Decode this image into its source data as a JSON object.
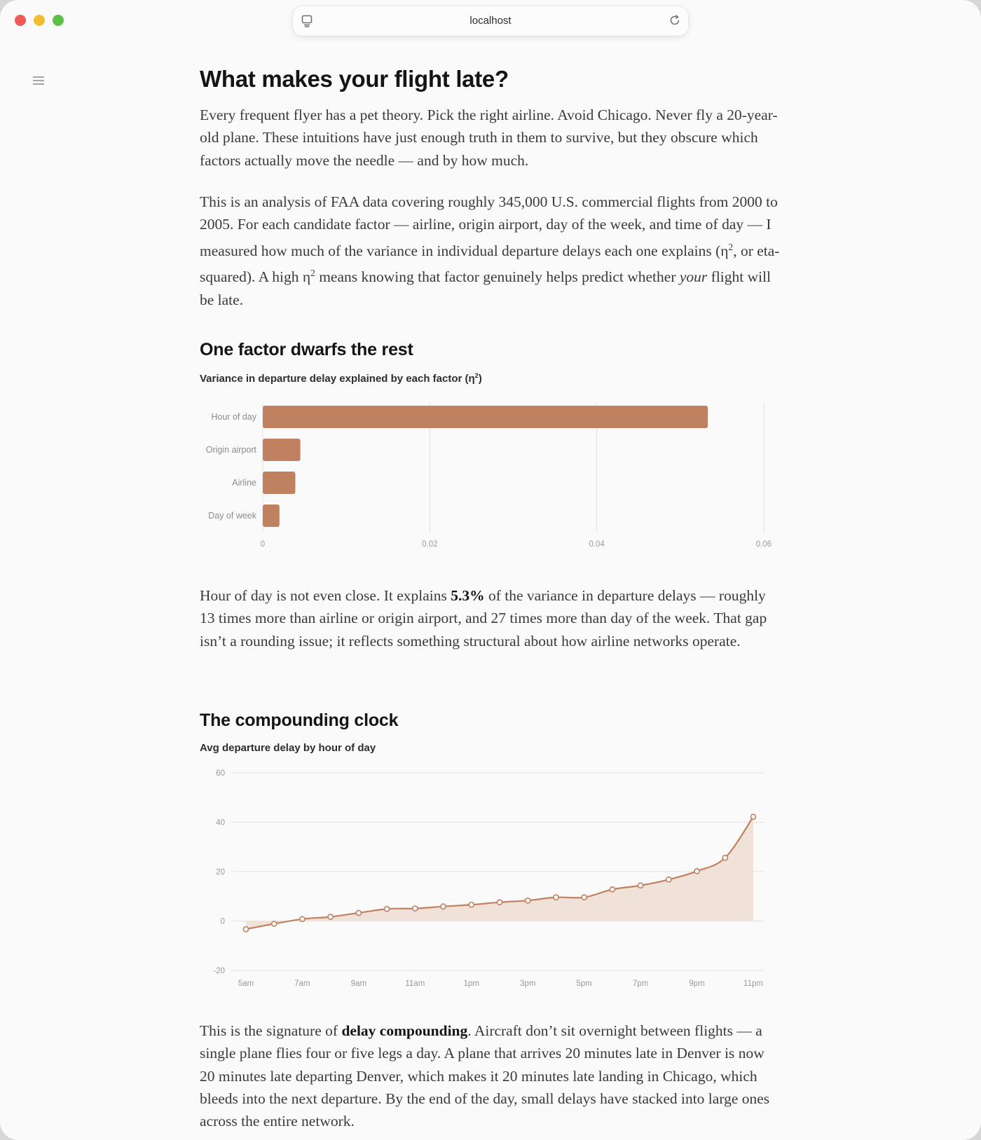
{
  "browser": {
    "url": "localhost"
  },
  "article": {
    "title": "What makes your flight late?",
    "intro_1": "Every frequent flyer has a pet theory. Pick the right airline. Avoid Chicago. Never fly a 20-year-old plane. These intuitions have just enough truth in them to survive, but they obscure which factors actually move the needle — and by how much.",
    "intro_2_a": "This is an analysis of FAA data covering roughly 345,000 U.S. commercial flights from 2000 to 2005. For each candidate factor — airline, origin airport, day of the week, and time of day — I measured how much of the variance in individual departure delays each one explains (η",
    "intro_2_sup1": "2",
    "intro_2_b": ", or eta-squared). A high η",
    "intro_2_sup2": "2",
    "intro_2_c": " means knowing that factor genuinely helps predict whether ",
    "intro_2_em": "your",
    "intro_2_d": " flight will be late.",
    "section_1": {
      "heading": "One factor dwarfs the rest",
      "chart_title_a": "Variance in departure delay explained by each factor (η",
      "chart_title_sup": "2",
      "chart_title_b": ")",
      "para_a": "Hour of day is not even close. It explains ",
      "para_bold": "5.3%",
      "para_b": " of the variance in departure delays — roughly 13 times more than airline or origin airport, and 27 times more than day of the week. That gap isn’t a rounding issue; it reflects something structural about how airline networks operate."
    },
    "section_2": {
      "heading": "The compounding clock",
      "chart_title": "Avg departure delay by hour of day",
      "para_a": "This is the signature of ",
      "para_bold": "delay compounding",
      "para_b": ". Aircraft don’t sit overnight between flights — a single plane flies four or five legs a day. A plane that arrives 20 minutes late in Denver is now 20 minutes late departing Denver, which makes it 20 minutes late landing in Chicago, which bleeds into the next departure. By the end of the day, small delays have stacked into large ones across the entire network."
    }
  },
  "icons": {
    "page": "page-icon",
    "reload": "reload-icon",
    "menu": "menu-icon"
  },
  "colors": {
    "accent": "#c08161",
    "area_fill": "#f0e2d9"
  },
  "chart_data": [
    {
      "type": "bar",
      "orientation": "horizontal",
      "categories": [
        "Hour of day",
        "Origin airport",
        "Airline",
        "Day of week"
      ],
      "values": [
        0.0533,
        0.0045,
        0.0039,
        0.002
      ],
      "xlim": [
        0,
        0.06
      ],
      "xticks": [
        "0",
        "0.02",
        "0.04",
        "0.06"
      ],
      "grid": true
    },
    {
      "type": "area",
      "x": [
        "5am",
        "6am",
        "7am",
        "8am",
        "9am",
        "10am",
        "11am",
        "12pm",
        "1pm",
        "2pm",
        "3pm",
        "4pm",
        "5pm",
        "6pm",
        "7pm",
        "8pm",
        "9pm",
        "10pm",
        "11pm"
      ],
      "values": [
        -3.3,
        -1.1,
        0.8,
        1.7,
        3.3,
        4.9,
        5.1,
        5.9,
        6.6,
        7.6,
        8.3,
        9.6,
        9.6,
        12.8,
        14.4,
        16.8,
        20.2,
        25.6,
        42.2
      ],
      "xticks": [
        "5am",
        "7am",
        "9am",
        "11am",
        "1pm",
        "3pm",
        "5pm",
        "7pm",
        "9pm",
        "11pm"
      ],
      "ylim": [
        -20,
        60
      ],
      "yticks": [
        "60",
        "40",
        "20",
        "0",
        "-20"
      ],
      "grid": true
    }
  ]
}
